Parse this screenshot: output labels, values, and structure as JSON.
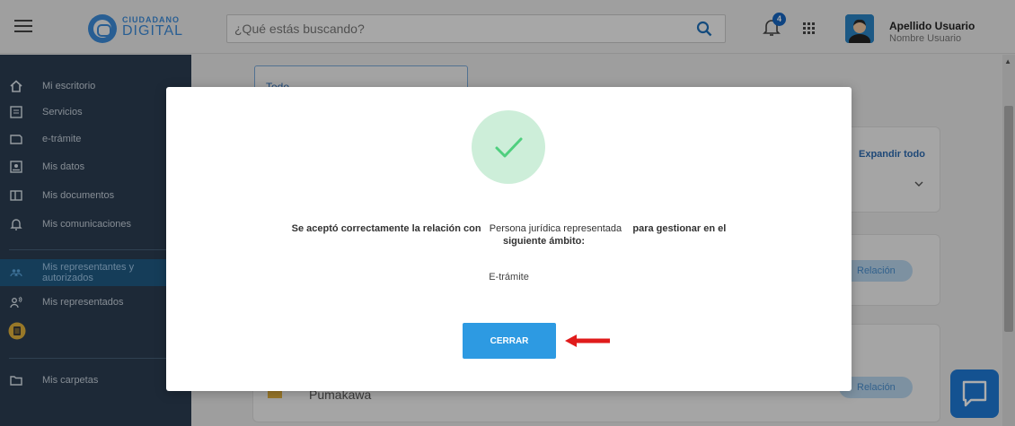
{
  "header": {
    "logo_line1": "CIUDADANO",
    "logo_line2": "DIGITAL",
    "search_placeholder": "¿Qué estás buscando?",
    "notifications_count": "4",
    "user_name": "Apellido Usuario",
    "user_subtitle": "Nombre Usuario"
  },
  "sidebar": {
    "items": [
      {
        "label": "Mi escritorio",
        "icon": "home-icon"
      },
      {
        "label": "Servicios",
        "icon": "list-icon"
      },
      {
        "label": "e-trámite",
        "icon": "folder-icon"
      },
      {
        "label": "Mis datos",
        "icon": "id-card-icon"
      },
      {
        "label": "Mis documentos",
        "icon": "documents-icon"
      },
      {
        "label": "Mis comunicaciones",
        "icon": "bell-icon"
      },
      {
        "label": "Mis representantes y autorizados",
        "icon": "people-icon",
        "active": true
      },
      {
        "label": "Mis representados",
        "icon": "person-speak-icon"
      },
      {
        "label": "Mis carpetas",
        "icon": "folder-icon"
      }
    ]
  },
  "main": {
    "filter_value": "Todo",
    "expand_all": "Expandir todo",
    "relation_chip": "Relación",
    "list_item_name": "Pumakawa"
  },
  "modal": {
    "message_part1": "Se aceptó correctamente la relación con",
    "entity": "Persona jurídica representada",
    "message_part2": "para gestionar en el",
    "message_part3": "siguiente ámbito:",
    "scope": "E-trámite",
    "close_label": "CERRAR"
  },
  "colors": {
    "primary": "#2d9ae2",
    "sidebar_bg": "#2b3d52",
    "success_circle": "#cdeed9",
    "success_check": "#4fcf7e",
    "arrow": "#e01b1b"
  }
}
